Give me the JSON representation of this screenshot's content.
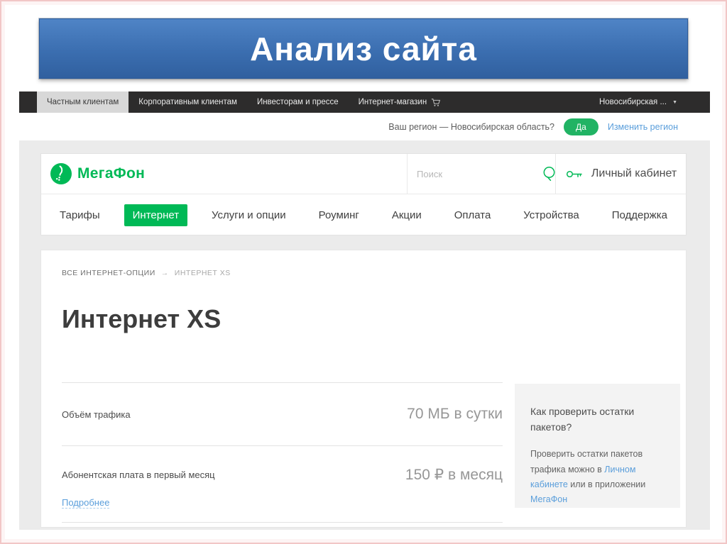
{
  "slide": {
    "title": "Анализ сайта"
  },
  "top_nav": {
    "tabs": [
      {
        "label": "Частным клиентам",
        "selected": true
      },
      {
        "label": "Корпоративным клиентам",
        "selected": false
      },
      {
        "label": "Инвесторам и прессе",
        "selected": false
      },
      {
        "label": "Интернет-магазин",
        "selected": false,
        "icon": "cart-icon"
      }
    ],
    "region_selector": "Новосибирская ...",
    "region_selector_icon": "chevron-down-icon"
  },
  "region_bar": {
    "question": "Ваш регион — Новосибирская область?",
    "yes_label": "Да",
    "change_link": "Изменить регион"
  },
  "site_header": {
    "logo_text": "МегаФон",
    "logo_icon": "megafon-logo-icon",
    "search_placeholder": "Поиск",
    "search_icon": "search-icon",
    "account_icon": "key-icon",
    "account_label": "Личный кабинет"
  },
  "main_nav": {
    "items": [
      {
        "label": "Тарифы",
        "active": false
      },
      {
        "label": "Интернет",
        "active": true
      },
      {
        "label": "Услуги и опции",
        "active": false
      },
      {
        "label": "Роуминг",
        "active": false
      },
      {
        "label": "Акции",
        "active": false
      },
      {
        "label": "Оплата",
        "active": false
      },
      {
        "label": "Устройства",
        "active": false
      },
      {
        "label": "Поддержка",
        "active": false
      }
    ]
  },
  "content": {
    "breadcrumb": {
      "root": "ВСЕ ИНТЕРНЕТ-ОПЦИИ",
      "arrow": "→",
      "current": "ИНТЕРНЕТ XS"
    },
    "title": "Интернет XS",
    "rows": [
      {
        "label": "Объём трафика",
        "value": "70 МБ в сутки"
      },
      {
        "label": "Абонентская плата в первый месяц",
        "value": "150 ₽ в месяц"
      }
    ],
    "details_link": "Подробнее",
    "sidebar": {
      "title": "Как проверить остатки пакетов?",
      "text_part1": "Проверить остатки пакетов трафика можно в ",
      "link1": "Личном кабинете",
      "text_part2": " или в приложении ",
      "link2": "МегаФон"
    }
  },
  "colors": {
    "brand_green": "#00b956",
    "banner_blue": "#3b6eb0",
    "dark_bar": "#2d2c2c",
    "link_blue": "#5a9edb",
    "yes_button_green": "#21b364",
    "page_bg_gray": "#ebebeb",
    "help_box_gray": "#f3f3f3",
    "frame_pink": "#f2c6c6"
  }
}
